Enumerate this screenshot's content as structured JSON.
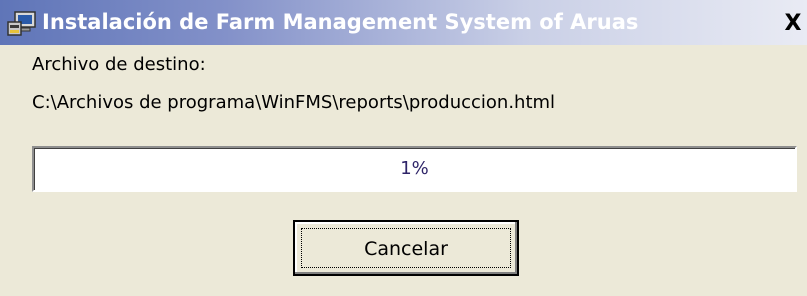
{
  "window": {
    "title": "Instalación de Farm Management System of Aruas",
    "close_label": "X",
    "icon": "installer-computer-icon"
  },
  "main": {
    "dest_label": "Archivo de destino:",
    "dest_path": "C:\\Archivos de programa\\WinFMS\\reports\\produccion.html"
  },
  "progress": {
    "text": "1%",
    "value_percent": 1
  },
  "buttons": {
    "cancel_label": "Cancelar"
  },
  "colors": {
    "titlebar_start": "#5f75b8",
    "titlebar_end": "#e9ebf4",
    "background": "#ece9d8",
    "progress_text": "#2e2468"
  }
}
